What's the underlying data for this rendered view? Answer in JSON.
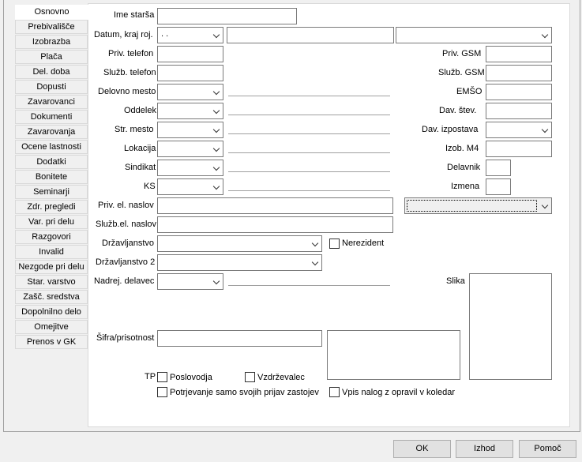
{
  "tabs": [
    {
      "label": "Osnovno",
      "active": true
    },
    {
      "label": "Prebivališče"
    },
    {
      "label": "Izobrazba"
    },
    {
      "label": "Plača"
    },
    {
      "label": "Del. doba"
    },
    {
      "label": "Dopusti"
    },
    {
      "label": "Zavarovanci"
    },
    {
      "label": "Dokumenti"
    },
    {
      "label": "Zavarovanja"
    },
    {
      "label": "Ocene lastnosti"
    },
    {
      "label": "Dodatki"
    },
    {
      "label": "Bonitete"
    },
    {
      "label": "Seminarji"
    },
    {
      "label": "Zdr. pregledi"
    },
    {
      "label": "Var. pri delu"
    },
    {
      "label": "Razgovori"
    },
    {
      "label": "Invalid"
    },
    {
      "label": "Nezgode pri delu"
    },
    {
      "label": "Star. varstvo"
    },
    {
      "label": "Zašč. sredstva"
    },
    {
      "label": "Dopolnilno delo"
    },
    {
      "label": "Omejitve"
    },
    {
      "label": "Prenos v GK"
    }
  ],
  "form": {
    "ime_starsa": {
      "label": "Ime starša",
      "value": ""
    },
    "datum_kraj": {
      "label": "Datum, kraj roj.",
      "date_value": " .  .",
      "place_value": "",
      "country_value": ""
    },
    "priv_telefon": {
      "label": "Priv. telefon",
      "value": ""
    },
    "sluzb_telefon": {
      "label": "Služb. telefon",
      "value": ""
    },
    "delovno_mesto": {
      "label": "Delovno mesto",
      "value": ""
    },
    "oddelek": {
      "label": "Oddelek",
      "value": ""
    },
    "str_mesto": {
      "label": "Str. mesto",
      "value": ""
    },
    "lokacija": {
      "label": "Lokacija",
      "value": ""
    },
    "sindikat": {
      "label": "Sindikat",
      "value": ""
    },
    "ks": {
      "label": "KS",
      "value": ""
    },
    "priv_el_naslov": {
      "label": "Priv. el. naslov",
      "value": ""
    },
    "sluzb_el_naslov": {
      "label": "Služb.el. naslov",
      "value": ""
    },
    "drzavljanstvo": {
      "label": "Državljanstvo",
      "value": ""
    },
    "nerezident": {
      "label": "Nerezident",
      "checked": false
    },
    "drzavljanstvo2": {
      "label": "Državljanstvo 2",
      "value": ""
    },
    "nadrej_delavec": {
      "label": "Nadrej. delavec",
      "value": ""
    },
    "sifra_prisotnost": {
      "label": "Šifra/prisotnost",
      "value": ""
    },
    "tp": {
      "label": "TP"
    },
    "poslovodja": {
      "label": "Poslovodja",
      "checked": false
    },
    "vzdrzevalec": {
      "label": "Vzdrževalec",
      "checked": false
    },
    "potrjevanje": {
      "label": "Potrjevanje samo svojih prijav zastojev",
      "checked": false
    },
    "vpis_nalog": {
      "label": "Vpis nalog z opravil v koledar",
      "checked": false
    },
    "priv_gsm": {
      "label": "Priv. GSM",
      "value": ""
    },
    "sluzb_gsm": {
      "label": "Služb. GSM",
      "value": ""
    },
    "emso": {
      "label": "EMŠO",
      "value": ""
    },
    "dav_stev": {
      "label": "Dav. štev.",
      "value": ""
    },
    "dav_izpostava": {
      "label": "Dav. izpostava",
      "value": ""
    },
    "izob_m4": {
      "label": "Izob. M4",
      "value": ""
    },
    "delavnik": {
      "label": "Delavnik",
      "value": ""
    },
    "izmena": {
      "label": "Izmena",
      "value": ""
    },
    "slika": {
      "label": "Slika"
    }
  },
  "buttons": {
    "ok": "OK",
    "izhod": "Izhod",
    "pomoc": "Pomoč"
  }
}
